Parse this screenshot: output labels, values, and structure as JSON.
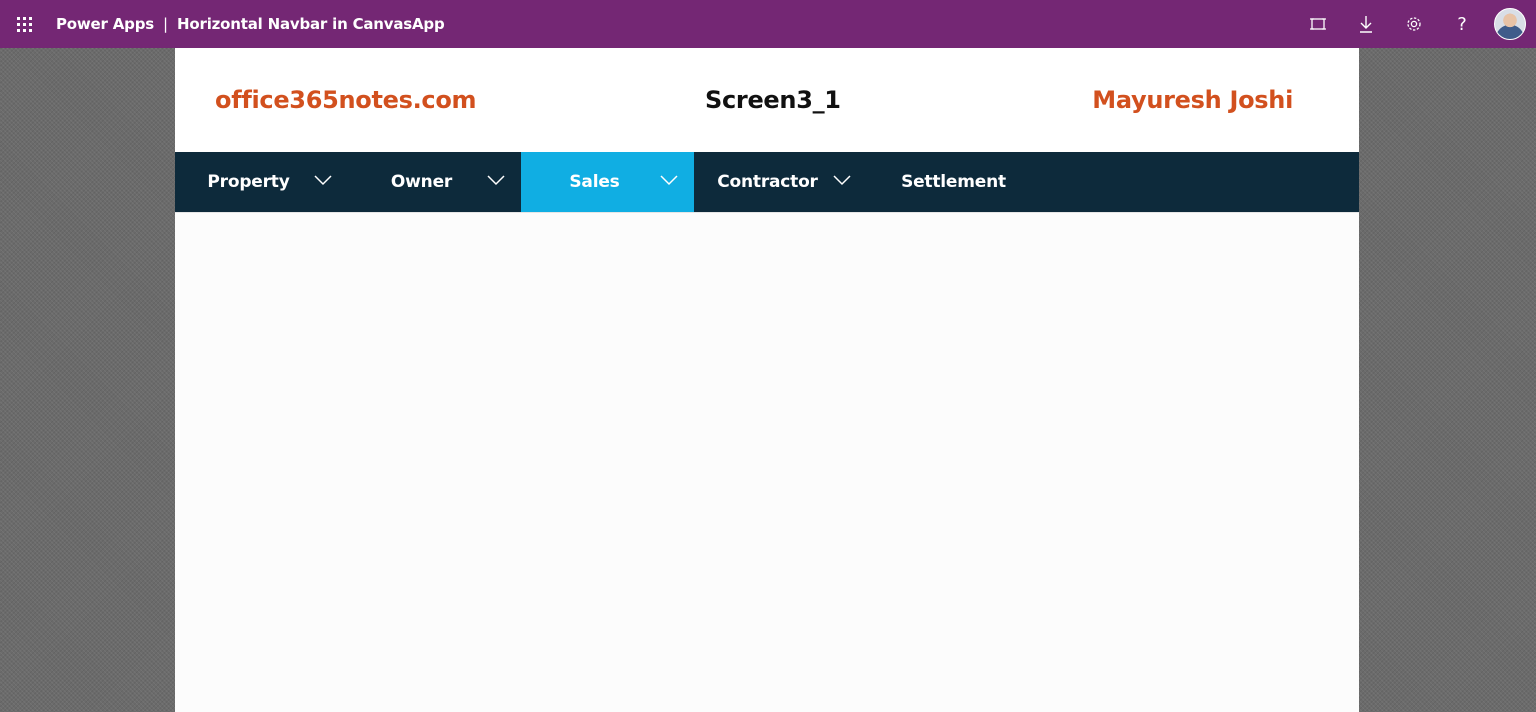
{
  "topbar": {
    "app_name": "Power Apps",
    "separator": "|",
    "app_title": "Horizontal Navbar in CanvasApp",
    "color": "#742774",
    "icons": [
      "fit-to-window-icon",
      "download-icon",
      "settings-icon",
      "help-icon",
      "user-avatar"
    ],
    "help_glyph": "?"
  },
  "header": {
    "brand": "office365notes.com",
    "screen_title": "Screen3_1",
    "author": "Mayuresh Joshi",
    "accent_color": "#d2501e"
  },
  "navbar": {
    "background": "#0d2a3b",
    "active_color": "#10aee3",
    "items": [
      {
        "label": "Property",
        "has_chevron": true,
        "active": false
      },
      {
        "label": "Owner",
        "has_chevron": true,
        "active": false
      },
      {
        "label": "Sales",
        "has_chevron": true,
        "active": true
      },
      {
        "label": "Contractor",
        "has_chevron": true,
        "active": false
      },
      {
        "label": "Settlement",
        "has_chevron": false,
        "active": false
      }
    ]
  }
}
